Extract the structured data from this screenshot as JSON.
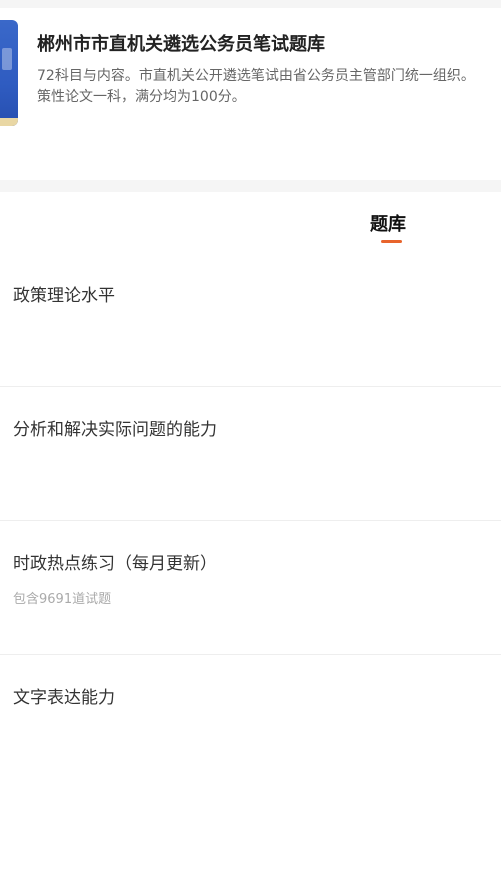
{
  "header": {
    "title": "郴州市市直机关遴选公务员笔试题库",
    "description_line1": "72科目与内容。市直机关公开遴选笔试由省公务员主管部门统一组织。",
    "description_line2": "策性论文一科，满分均为100分。"
  },
  "tabs": [
    {
      "label": "题库",
      "active": true
    }
  ],
  "accent_color": "#e8642c",
  "list": [
    {
      "title": "政策理论水平",
      "subtitle": ""
    },
    {
      "title": "分析和解决实际问题的能力",
      "subtitle": ""
    },
    {
      "title": "时政热点练习（每月更新）",
      "subtitle": "包含9691道试题"
    },
    {
      "title": "文字表达能力",
      "subtitle": ""
    }
  ]
}
